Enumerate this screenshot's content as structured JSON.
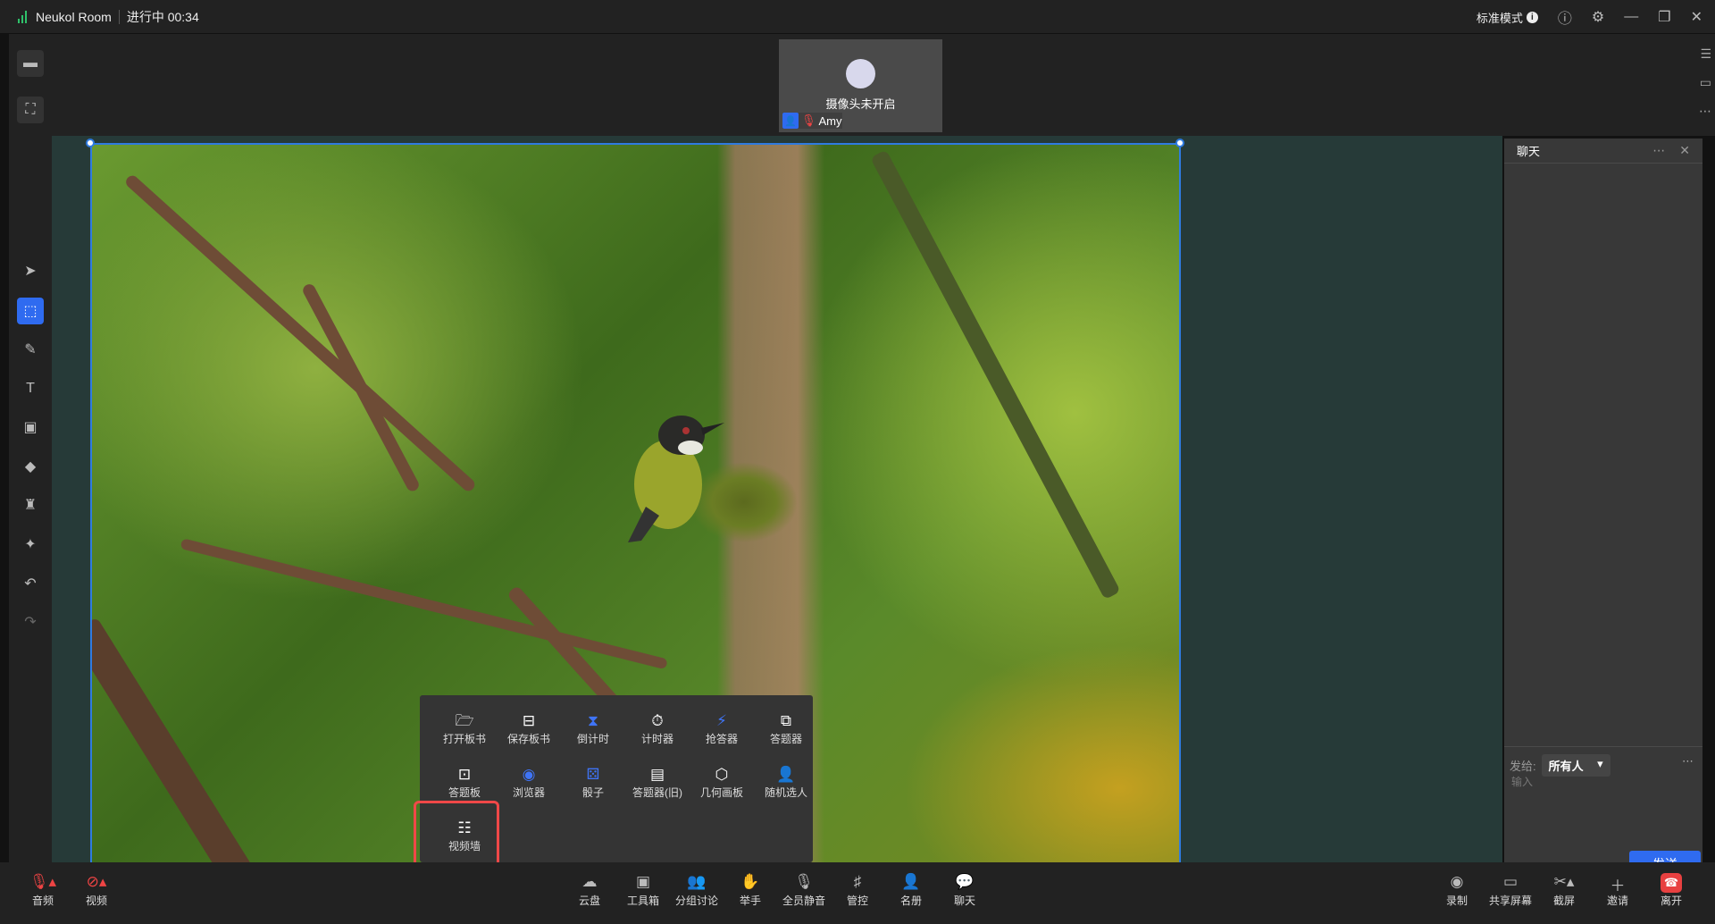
{
  "titlebar": {
    "app_name": "Neukol Room",
    "status": "进行中 00:34",
    "mode": "标准模式"
  },
  "video": {
    "camera_off": "摄像头未开启",
    "participant": "Amy"
  },
  "chat": {
    "title": "聊天",
    "send_to_label": "发给:",
    "recipient": "所有人",
    "input_placeholder": "输入",
    "send": "发送"
  },
  "toolbox": {
    "items": [
      {
        "label": "打开板书",
        "icon": "folder-open-icon"
      },
      {
        "label": "保存板书",
        "icon": "save-icon"
      },
      {
        "label": "倒计时",
        "icon": "hourglass-icon"
      },
      {
        "label": "计时器",
        "icon": "stopwatch-icon"
      },
      {
        "label": "抢答器",
        "icon": "buzzer-icon"
      },
      {
        "label": "答题器",
        "icon": "quiz-icon"
      },
      {
        "label": "答题板",
        "icon": "answer-board-icon"
      },
      {
        "label": "浏览器",
        "icon": "compass-icon"
      },
      {
        "label": "骰子",
        "icon": "dice-icon"
      },
      {
        "label": "答题器(旧)",
        "icon": "quiz-old-icon"
      },
      {
        "label": "几何画板",
        "icon": "cube-icon"
      },
      {
        "label": "随机选人",
        "icon": "random-person-icon"
      },
      {
        "label": "视频墙",
        "icon": "video-wall-icon"
      }
    ]
  },
  "bottom": {
    "left": [
      {
        "label": "音频",
        "icon": "mic-off-icon"
      },
      {
        "label": "视频",
        "icon": "camera-off-icon"
      }
    ],
    "center": [
      {
        "label": "云盘",
        "icon": "cloud-icon"
      },
      {
        "label": "工具箱",
        "icon": "toolbox-icon"
      },
      {
        "label": "分组讨论",
        "icon": "group-icon"
      },
      {
        "label": "举手",
        "icon": "hand-icon"
      },
      {
        "label": "全员静音",
        "icon": "mute-all-icon"
      },
      {
        "label": "管控",
        "icon": "control-icon"
      },
      {
        "label": "名册",
        "icon": "roster-icon"
      },
      {
        "label": "聊天",
        "icon": "chat-icon"
      }
    ],
    "right": [
      {
        "label": "录制",
        "icon": "record-icon"
      },
      {
        "label": "共享屏幕",
        "icon": "share-screen-icon"
      },
      {
        "label": "截屏",
        "icon": "scissors-icon"
      },
      {
        "label": "邀请",
        "icon": "plus-icon"
      },
      {
        "label": "离开",
        "icon": "hangup-icon"
      }
    ]
  },
  "colors": {
    "accent": "#2f6bf0",
    "leave": "#e84040",
    "highlight": "#f04848"
  }
}
